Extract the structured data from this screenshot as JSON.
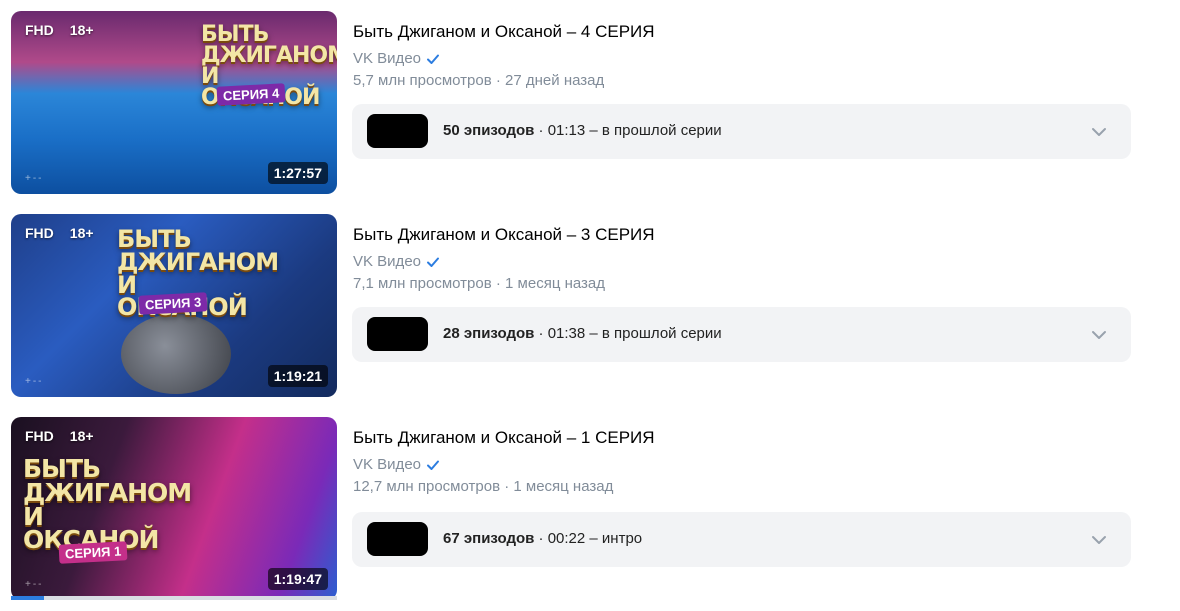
{
  "videos": [
    {
      "badge_quality": "FHD",
      "badge_age": "18+",
      "duration": "1:27:57",
      "title": "Быть Джиганом и Оксаной – 4 СЕРИЯ",
      "channel": "VK Видео",
      "views": "5,7 млн просмотров",
      "date": "27 дней назад",
      "episodes_count": "50 эпизодов",
      "episodes_rest": " · 01:13 – в прошлой серии",
      "thumb_text": "БЫТЬ ДЖИГАНОМ И ОКСАНОЙ",
      "thumb_series": "СЕРИЯ 4"
    },
    {
      "badge_quality": "FHD",
      "badge_age": "18+",
      "duration": "1:19:21",
      "title": "Быть Джиганом и Оксаной – 3 СЕРИЯ",
      "channel": "VK Видео",
      "views": "7,1 млн просмотров",
      "date": "1 месяц назад",
      "episodes_count": "28 эпизодов",
      "episodes_rest": " · 01:38 – в прошлой серии",
      "thumb_text": "БЫТЬ ДЖИГАНОМ И ОКСАНОЙ",
      "thumb_series": "СЕРИЯ 3"
    },
    {
      "badge_quality": "FHD",
      "badge_age": "18+",
      "duration": "1:19:47",
      "title": "Быть Джиганом и Оксаной – 1 СЕРИЯ",
      "channel": "VK Видео",
      "views": "12,7 млн просмотров",
      "date": "1 месяц назад",
      "episodes_count": "67 эпизодов",
      "episodes_rest": " · 00:22 – интро",
      "thumb_text": "БЫТЬ ДЖИГАНОМ И ОКСАНОЙ",
      "thumb_series": "СЕРИЯ 1",
      "watch_progress": 0.1
    }
  ],
  "separator": " · ",
  "colors": {
    "accent_blue": "#2c7de0",
    "meta_gray": "#818c99",
    "episodes_bg": "#f2f3f5"
  }
}
